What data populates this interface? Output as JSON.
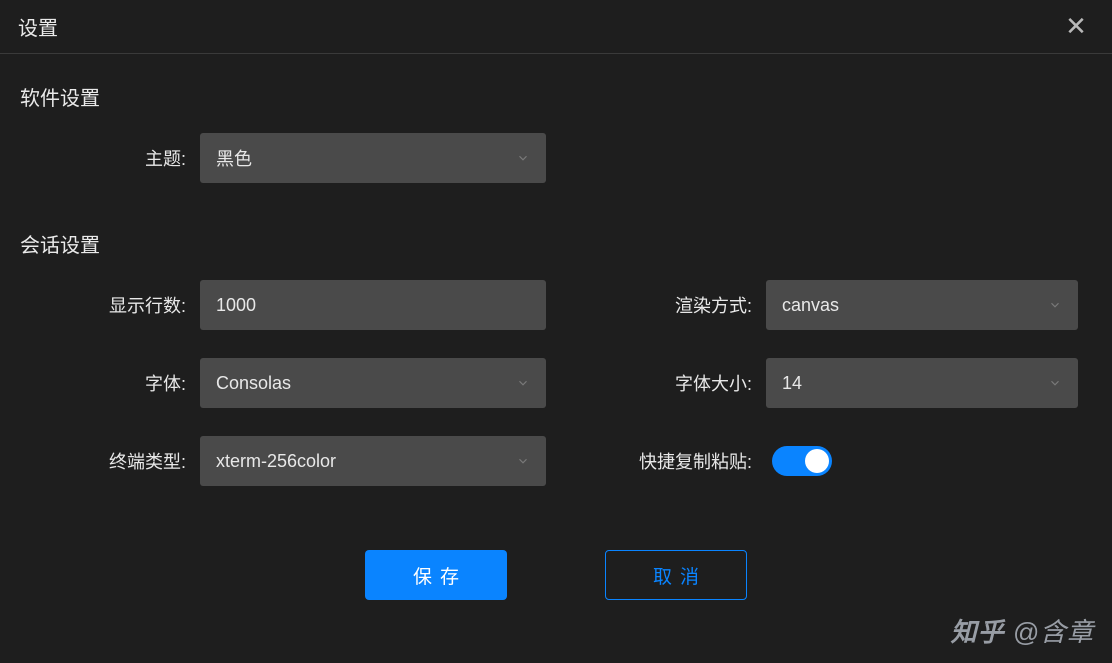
{
  "titlebar": {
    "title": "设置"
  },
  "sections": {
    "software": {
      "title": "软件设置",
      "theme_label": "主题:",
      "theme_value": "黑色"
    },
    "session": {
      "title": "会话设置",
      "rows_label": "显示行数:",
      "rows_value": "1000",
      "render_label": "渲染方式:",
      "render_value": "canvas",
      "font_label": "字体:",
      "font_value": "Consolas",
      "fontsize_label": "字体大小:",
      "fontsize_value": "14",
      "termtype_label": "终端类型:",
      "termtype_value": "xterm-256color",
      "quickcopy_label": "快捷复制粘贴:",
      "quickcopy_on": true
    }
  },
  "buttons": {
    "save": "保存",
    "cancel": "取消"
  },
  "watermark": {
    "site": "知乎",
    "at": "@含章"
  }
}
